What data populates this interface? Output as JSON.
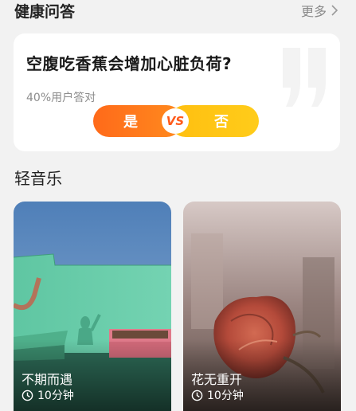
{
  "health_qa": {
    "title": "健康问答",
    "more_label": "更多",
    "question": "空腹吃香蕉会增加心脏负荷?",
    "stat": "40%用户答对",
    "yes_label": "是",
    "vs_label": "VS",
    "no_label": "否",
    "colors": {
      "yes": "#ff6a1a",
      "no": "#ffc214"
    }
  },
  "light_music": {
    "title": "轻音乐",
    "cards": [
      {
        "name": "不期而遇",
        "duration": "10分钟",
        "icon": "clock-icon"
      },
      {
        "name": "花无重开",
        "duration": "10分钟",
        "icon": "clock-icon"
      }
    ]
  }
}
